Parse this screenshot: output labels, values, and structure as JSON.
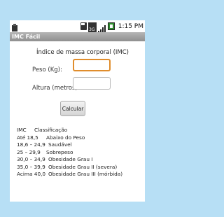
{
  "status": {
    "time": "1:15 PM"
  },
  "title": "IMC Fácil",
  "heading": "Índice de massa corporal (IMC)",
  "form": {
    "peso_label": "Peso (Kg):",
    "peso_value": "",
    "altura_label": "Altura (metros):",
    "altura_value": "",
    "calc_button": "Calcular"
  },
  "table": {
    "header": [
      "IMC",
      "Classificação"
    ],
    "rows": [
      [
        "Até 18,5",
        "Abaixo do Peso"
      ],
      [
        "18,6 – 24,9",
        "Saudável"
      ],
      [
        "25 – 29,9",
        "Sobrepeso"
      ],
      [
        "30,0 – 34,9",
        "Obesidade Grau I"
      ],
      [
        "35,0 – 39,9",
        "Obesidade Grau II (severa)"
      ],
      [
        "Acima 40,0",
        "Obesidade Grau III (mórbida)"
      ]
    ]
  }
}
